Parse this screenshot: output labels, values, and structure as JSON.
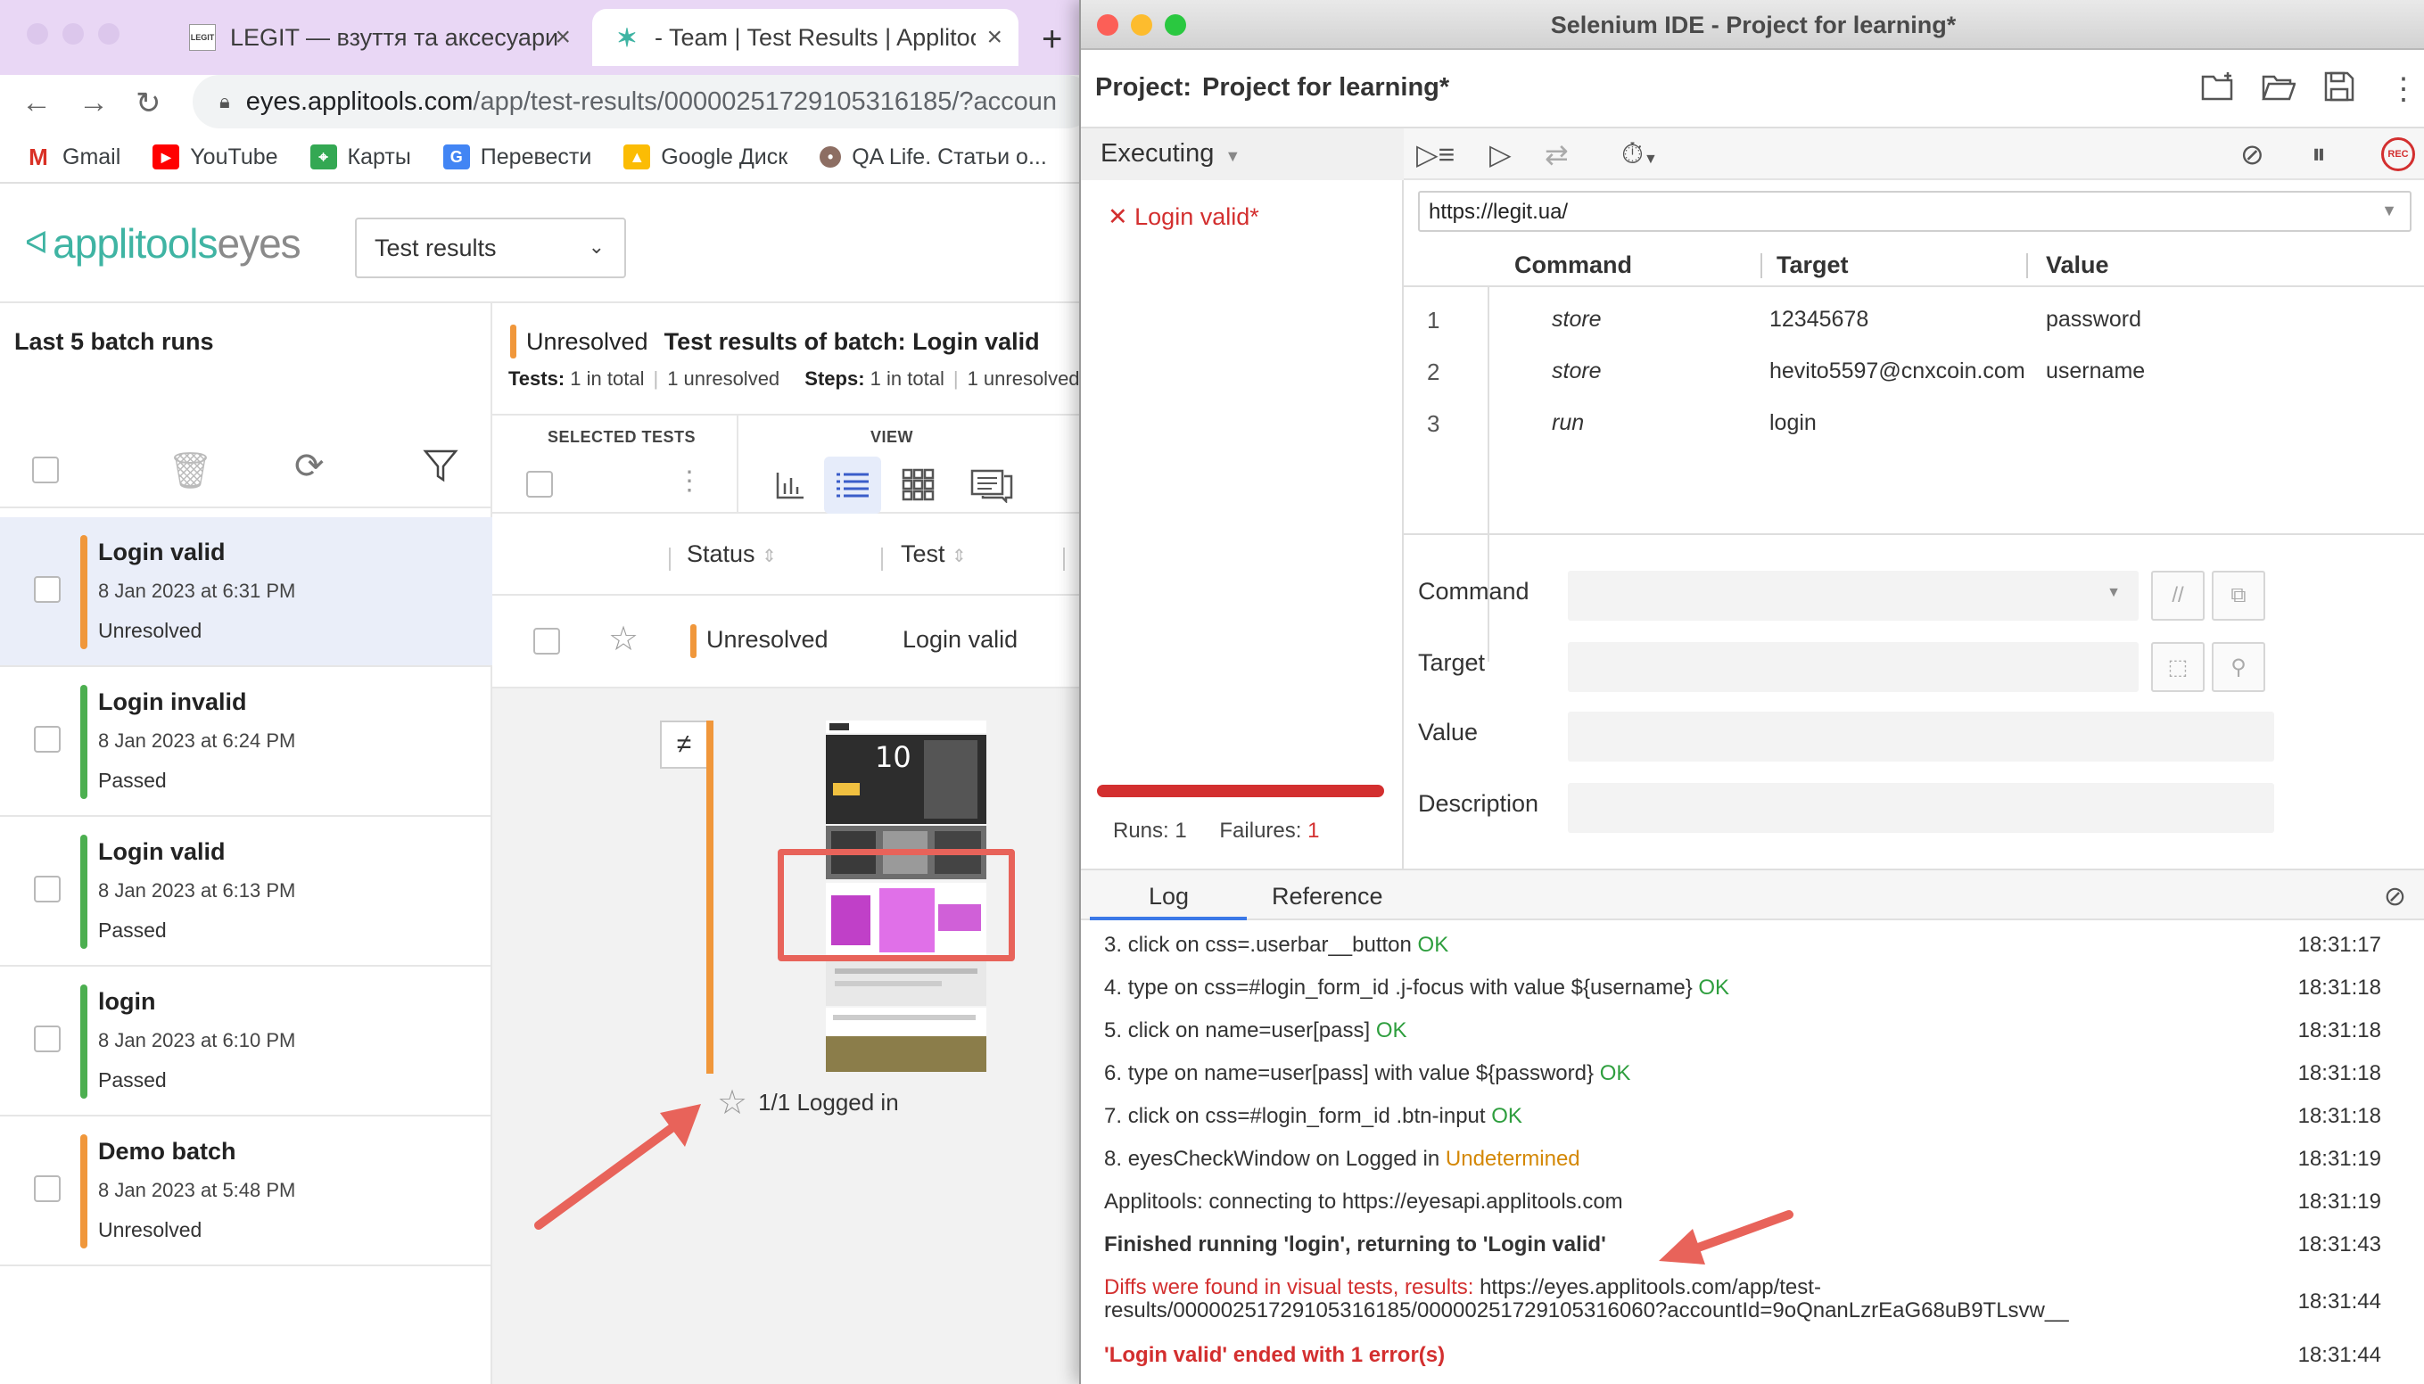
{
  "browser": {
    "tabs": [
      {
        "label": "LEGIT — взуття та аксесуари",
        "favicon": "LEGIT"
      },
      {
        "label": "- Team | Test Results | Applitoo"
      }
    ],
    "url_host": "eyes.applitools.com",
    "url_path": "/app/test-results/00000251729105316185/?accoun",
    "bookmarks": [
      "Gmail",
      "YouTube",
      "Карты",
      "Перевести",
      "Google Диск",
      "QA Life. Статьи о..."
    ]
  },
  "applitools": {
    "logo_brand": "applitools",
    "logo_eyes": "eyes",
    "view_select": "Test results",
    "sidebar_title": "Last 5 batch runs",
    "batches": [
      {
        "name": "Login valid",
        "date": "8 Jan 2023 at 6:31 PM",
        "status": "Unresolved",
        "color": "#f0973b"
      },
      {
        "name": "Login invalid",
        "date": "8 Jan 2023 at 6:24 PM",
        "status": "Passed",
        "color": "#4caf50"
      },
      {
        "name": "Login valid",
        "date": "8 Jan 2023 at 6:13 PM",
        "status": "Passed",
        "color": "#4caf50"
      },
      {
        "name": "login",
        "date": "8 Jan 2023 at 6:10 PM",
        "status": "Passed",
        "color": "#4caf50"
      },
      {
        "name": "Demo batch",
        "date": "8 Jan 2023 at 5:48 PM",
        "status": "Unresolved",
        "color": "#f0973b"
      }
    ],
    "summary_status": "Unresolved",
    "summary_title": "Test results of batch:  Login valid",
    "tests_label": "Tests:",
    "tests_total": "1 in total",
    "tests_unresolved": "1 unresolved",
    "steps_label": "Steps:",
    "steps_total": "1 in total",
    "steps_unresolved": "1 unresolved",
    "selected_tests_label": "SELECTED TESTS",
    "view_label": "VIEW",
    "col_status": "Status",
    "col_test": "Test",
    "row_status": "Unresolved",
    "row_test": "Login valid",
    "thumb_caption": "1/1 Logged in"
  },
  "ide": {
    "window_title": "Selenium IDE - Project for learning*",
    "project_label": "Project:",
    "project_name": "Project for learning*",
    "executing_label": "Executing",
    "test_name": "Login valid*",
    "runs_label": "Runs: 1",
    "failures_label": "Failures:",
    "failures_count": "1",
    "base_url": "https://legit.ua/",
    "col_command": "Command",
    "col_target": "Target",
    "col_value": "Value",
    "commands": [
      {
        "num": "1",
        "command": "store",
        "target": "12345678",
        "value": "password"
      },
      {
        "num": "2",
        "command": "store",
        "target": "hevito5597@cnxcoin.com",
        "value": "username"
      },
      {
        "num": "3",
        "command": "run",
        "target": "login",
        "value": ""
      }
    ],
    "editor_command": "Command",
    "editor_target": "Target",
    "editor_value": "Value",
    "editor_description": "Description",
    "tab_log": "Log",
    "tab_reference": "Reference",
    "log": [
      {
        "n": "3.",
        "text": "click on css=.userbar__button",
        "status": "OK",
        "time": "18:31:17"
      },
      {
        "n": "4.",
        "text": "type on css=#login_form_id .j-focus with value ${username}",
        "status": "OK",
        "time": "18:31:18"
      },
      {
        "n": "5.",
        "text": "click on name=user[pass]",
        "status": "OK",
        "time": "18:31:18"
      },
      {
        "n": "6.",
        "text": "type on name=user[pass] with value ${password}",
        "status": "OK",
        "time": "18:31:18"
      },
      {
        "n": "7.",
        "text": "click on css=#login_form_id .btn-input",
        "status": "OK",
        "time": "18:31:18"
      },
      {
        "n": "8.",
        "text": "eyesCheckWindow on Logged in",
        "status": "Undetermined",
        "time": "18:31:19"
      }
    ],
    "log_connect": "Applitools: connecting to https://eyesapi.applitools.com",
    "log_connect_time": "18:31:19",
    "log_finished": "Finished running 'login', returning to 'Login valid'",
    "log_finished_time": "18:31:43",
    "log_diffs_prefix": "Diffs were found in visual tests, results:",
    "log_diffs_url1": " https://eyes.applitools.com/app/test-",
    "log_diffs_url2": "results/00000251729105316185/00000251729105316060?accountId=9oQnanLzrEaG68uB9TLsvw__",
    "log_diffs_time": "18:31:44",
    "log_ended": "'Login valid' ended with 1 error(s)",
    "log_ended_time": "18:31:44"
  },
  "colors": {
    "unresolved": "#f0973b",
    "passed": "#4caf50",
    "error": "#d32f2f",
    "ok": "#2e9e3e",
    "accent": "#3fb4a3",
    "annotation": "#e8635a"
  }
}
